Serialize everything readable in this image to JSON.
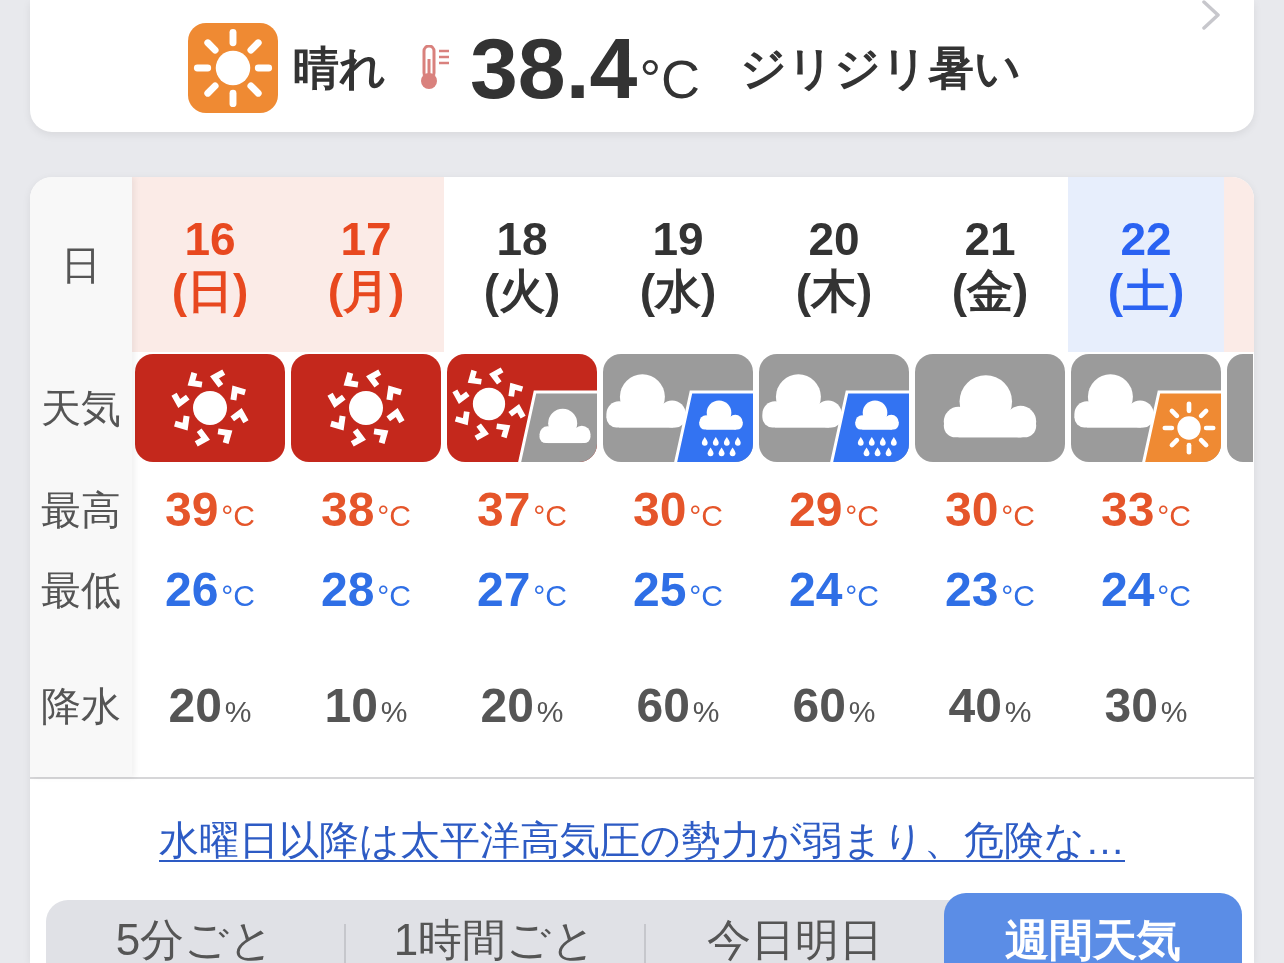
{
  "current": {
    "kind": "sun",
    "condition": "晴れ",
    "temperature": "38.4",
    "unit": "°C",
    "feel": "ジリジリ暑い"
  },
  "forecast": {
    "row_labels": [
      "日",
      "天気",
      "最高",
      "最低",
      "降水"
    ],
    "days": [
      {
        "kind": "sunday",
        "date": "16",
        "weekday": "(日)",
        "weather": [
          {
            "kind": "hot_sun"
          }
        ],
        "high": {
          "value": "39",
          "unit": "°C"
        },
        "low": {
          "value": "26",
          "unit": "°C"
        },
        "precipitation": {
          "value": "20",
          "unit": "%"
        }
      },
      {
        "kind": "holiday",
        "date": "17",
        "weekday": "(月)",
        "weather": [
          {
            "kind": "hot_sun"
          }
        ],
        "high": {
          "value": "38",
          "unit": "°C"
        },
        "low": {
          "value": "28",
          "unit": "°C"
        },
        "precipitation": {
          "value": "10",
          "unit": "%"
        }
      },
      {
        "kind": "weekday",
        "date": "18",
        "weekday": "(火)",
        "weather": [
          {
            "kind": "hot_sun"
          },
          {
            "kind": "cloud"
          }
        ],
        "high": {
          "value": "37",
          "unit": "°C"
        },
        "low": {
          "value": "27",
          "unit": "°C"
        },
        "precipitation": {
          "value": "20",
          "unit": "%"
        }
      },
      {
        "kind": "weekday",
        "date": "19",
        "weekday": "(水)",
        "weather": [
          {
            "kind": "cloud"
          },
          {
            "kind": "rain"
          }
        ],
        "high": {
          "value": "30",
          "unit": "°C"
        },
        "low": {
          "value": "25",
          "unit": "°C"
        },
        "precipitation": {
          "value": "60",
          "unit": "%"
        }
      },
      {
        "kind": "weekday",
        "date": "20",
        "weekday": "(木)",
        "weather": [
          {
            "kind": "cloud"
          },
          {
            "kind": "rain"
          }
        ],
        "high": {
          "value": "29",
          "unit": "°C"
        },
        "low": {
          "value": "24",
          "unit": "°C"
        },
        "precipitation": {
          "value": "60",
          "unit": "%"
        }
      },
      {
        "kind": "weekday",
        "date": "21",
        "weekday": "(金)",
        "weather": [
          {
            "kind": "cloud"
          }
        ],
        "high": {
          "value": "30",
          "unit": "°C"
        },
        "low": {
          "value": "23",
          "unit": "°C"
        },
        "precipitation": {
          "value": "40",
          "unit": "%"
        }
      },
      {
        "kind": "saturday",
        "date": "22",
        "weekday": "(土)",
        "weather": [
          {
            "kind": "cloud"
          },
          {
            "kind": "sun"
          }
        ],
        "high": {
          "value": "33",
          "unit": "°C"
        },
        "low": {
          "value": "24",
          "unit": "°C"
        },
        "precipitation": {
          "value": "30",
          "unit": "%"
        }
      }
    ],
    "cut_off_day": {
      "kind": "sunday",
      "weather": [
        {
          "kind": "cloud"
        }
      ]
    }
  },
  "news_link": "水曜日以降は太平洋高気圧の勢力が弱まり、危険な…",
  "tabs": [
    {
      "label": "5分ごと",
      "selected": false
    },
    {
      "label": "1時間ごと",
      "selected": false
    },
    {
      "label": "今日明日",
      "selected": false
    },
    {
      "label": "週間天気",
      "selected": true
    }
  ]
}
